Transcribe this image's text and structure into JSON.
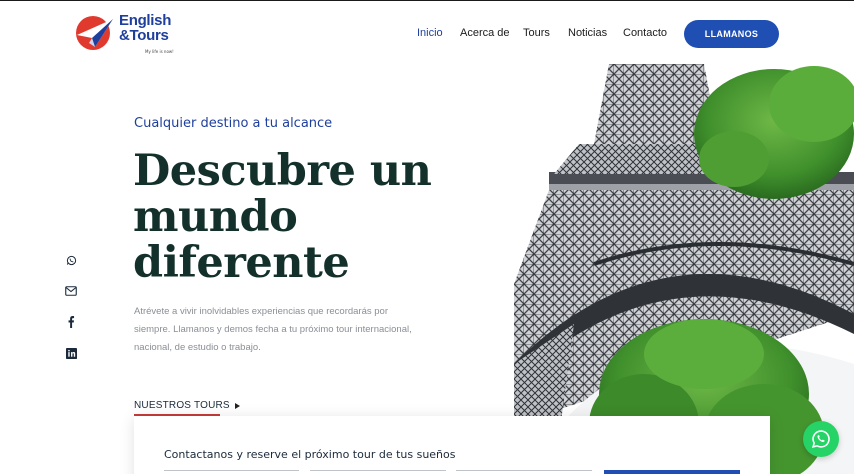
{
  "brand": {
    "name_line1": "English",
    "name_line2": "&Tours",
    "tagline": "My life is now!",
    "primary_color": "#1f3f9d",
    "accent_color": "#e03a2f"
  },
  "nav": {
    "items": [
      {
        "label": "Inicio",
        "active": true
      },
      {
        "label": "Acerca de",
        "active": false
      },
      {
        "label": "Tours",
        "active": false
      },
      {
        "label": "Noticias",
        "active": false
      },
      {
        "label": "Contacto",
        "active": false
      }
    ],
    "cta_label": "LLAMANOS",
    "cta_color": "#1f4fb3"
  },
  "hero": {
    "eyebrow": "Cualquier destino a tu alcance",
    "headline_lines": [
      "Descubre un",
      "mundo",
      "diferente"
    ],
    "description": "Atrévete a vivir inolvidables experiencias que recordarás por siempre. Llamanos y demos fecha a tu próximo tour internacional, nacional, de estudio o trabajo.",
    "tours_link_label": "NUESTROS TOURS",
    "image_icon": "eiffel-tower-photo"
  },
  "social": {
    "icons": [
      "whatsapp-icon",
      "email-icon",
      "facebook-icon",
      "linkedin-icon"
    ]
  },
  "form": {
    "title": "Contactanos y reserve el próximo tour de tus sueños"
  },
  "floating": {
    "icon": "whatsapp-icon",
    "color": "#25d366"
  }
}
